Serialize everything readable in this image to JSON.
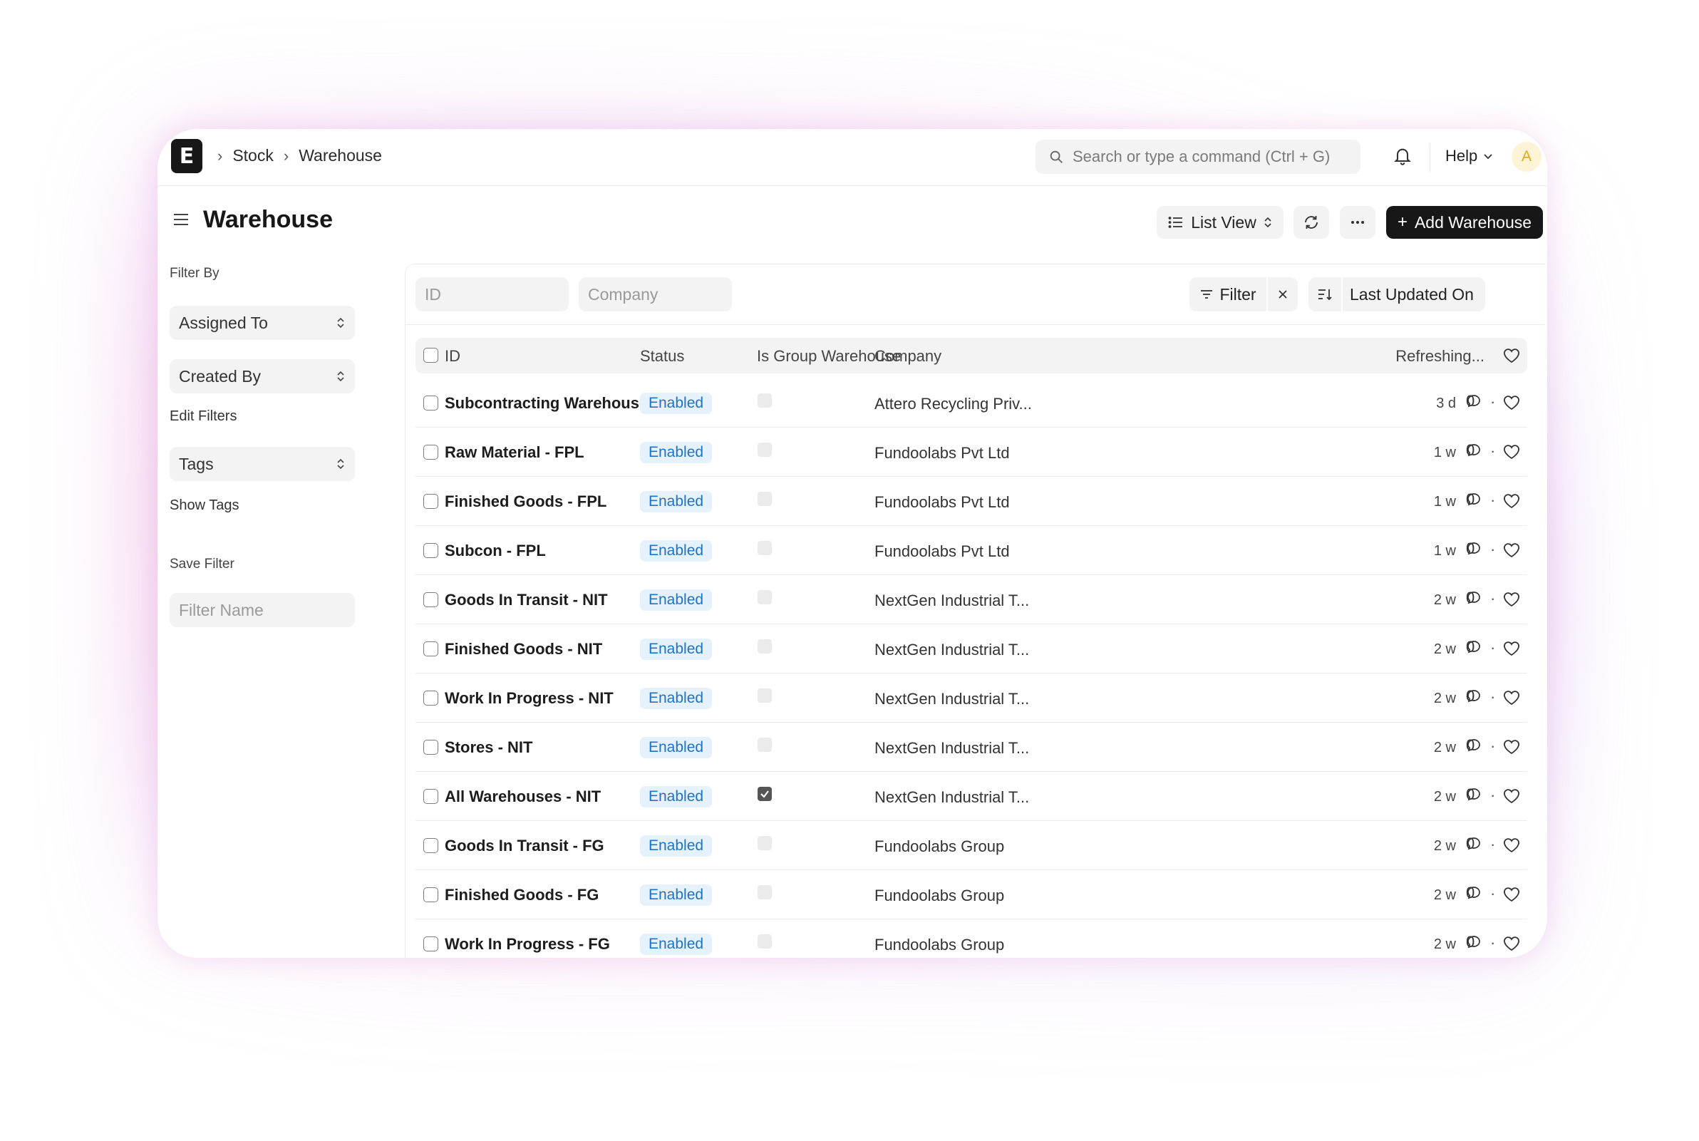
{
  "nav": {
    "logo": "E",
    "breadcrumbs": [
      "Stock",
      "Warehouse"
    ],
    "search_placeholder": "Search or type a command (Ctrl + G)",
    "help_label": "Help",
    "avatar_initial": "A"
  },
  "header": {
    "title": "Warehouse",
    "list_view_label": "List View",
    "add_label": "Add Warehouse"
  },
  "sidebar": {
    "filter_by": "Filter By",
    "assigned_to": "Assigned To",
    "created_by": "Created By",
    "edit_filters": "Edit Filters",
    "tags": "Tags",
    "show_tags": "Show Tags",
    "save_filter": "Save Filter",
    "filter_name_placeholder": "Filter Name"
  },
  "filters": {
    "id_placeholder": "ID",
    "company_placeholder": "Company",
    "filter_label": "Filter",
    "sort_label": "Last Updated On"
  },
  "table": {
    "columns": [
      "ID",
      "Status",
      "Is Group Warehouse",
      "Company",
      "Refreshing..."
    ],
    "rows": [
      {
        "id": "Subcontracting Warehouse - ARPL",
        "status": "Enabled",
        "is_group": false,
        "company": "Attero Recycling Priv...",
        "time": "3 d",
        "comments": "0"
      },
      {
        "id": "Raw Material - FPL",
        "status": "Enabled",
        "is_group": false,
        "company": "Fundoolabs Pvt Ltd",
        "time": "1 w",
        "comments": "0"
      },
      {
        "id": "Finished Goods - FPL",
        "status": "Enabled",
        "is_group": false,
        "company": "Fundoolabs Pvt Ltd",
        "time": "1 w",
        "comments": "0"
      },
      {
        "id": "Subcon - FPL",
        "status": "Enabled",
        "is_group": false,
        "company": "Fundoolabs Pvt Ltd",
        "time": "1 w",
        "comments": "0"
      },
      {
        "id": "Goods In Transit - NIT",
        "status": "Enabled",
        "is_group": false,
        "company": "NextGen Industrial T...",
        "time": "2 w",
        "comments": "0"
      },
      {
        "id": "Finished Goods - NIT",
        "status": "Enabled",
        "is_group": false,
        "company": "NextGen Industrial T...",
        "time": "2 w",
        "comments": "0"
      },
      {
        "id": "Work In Progress - NIT",
        "status": "Enabled",
        "is_group": false,
        "company": "NextGen Industrial T...",
        "time": "2 w",
        "comments": "0"
      },
      {
        "id": "Stores - NIT",
        "status": "Enabled",
        "is_group": false,
        "company": "NextGen Industrial T...",
        "time": "2 w",
        "comments": "0"
      },
      {
        "id": "All Warehouses - NIT",
        "status": "Enabled",
        "is_group": true,
        "company": "NextGen Industrial T...",
        "time": "2 w",
        "comments": "0"
      },
      {
        "id": "Goods In Transit - FG",
        "status": "Enabled",
        "is_group": false,
        "company": "Fundoolabs Group",
        "time": "2 w",
        "comments": "0"
      },
      {
        "id": "Finished Goods - FG",
        "status": "Enabled",
        "is_group": false,
        "company": "Fundoolabs Group",
        "time": "2 w",
        "comments": "0"
      },
      {
        "id": "Work In Progress - FG",
        "status": "Enabled",
        "is_group": false,
        "company": "Fundoolabs Group",
        "time": "2 w",
        "comments": "0"
      }
    ]
  },
  "colors": {
    "accent_dark": "#171717",
    "badge_bg": "#e6f2fb",
    "badge_text": "#1f73c4"
  }
}
